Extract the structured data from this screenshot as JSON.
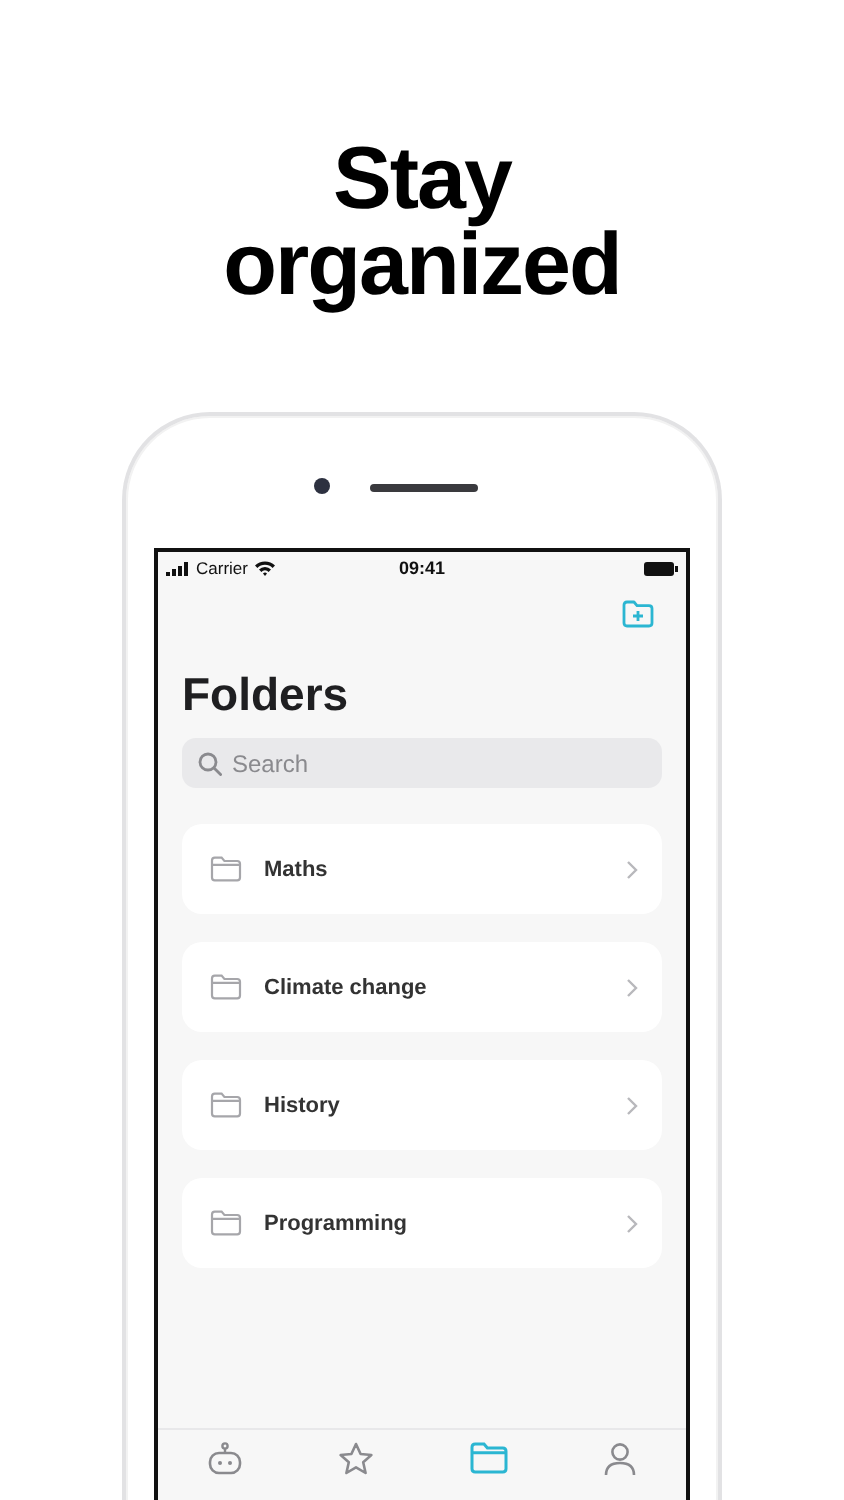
{
  "headline": [
    "Stay",
    "organized"
  ],
  "status_bar": {
    "carrier": "Carrier",
    "time": "09:41"
  },
  "title": "Folders",
  "search": {
    "placeholder": "Search"
  },
  "folders": [
    {
      "name": "Maths"
    },
    {
      "name": "Climate change"
    },
    {
      "name": "History"
    },
    {
      "name": "Programming"
    }
  ],
  "tab_bar": [
    {
      "kind": "bot",
      "selected": false
    },
    {
      "kind": "star",
      "selected": false
    },
    {
      "kind": "folder",
      "selected": true
    },
    {
      "kind": "person",
      "selected": false
    }
  ]
}
